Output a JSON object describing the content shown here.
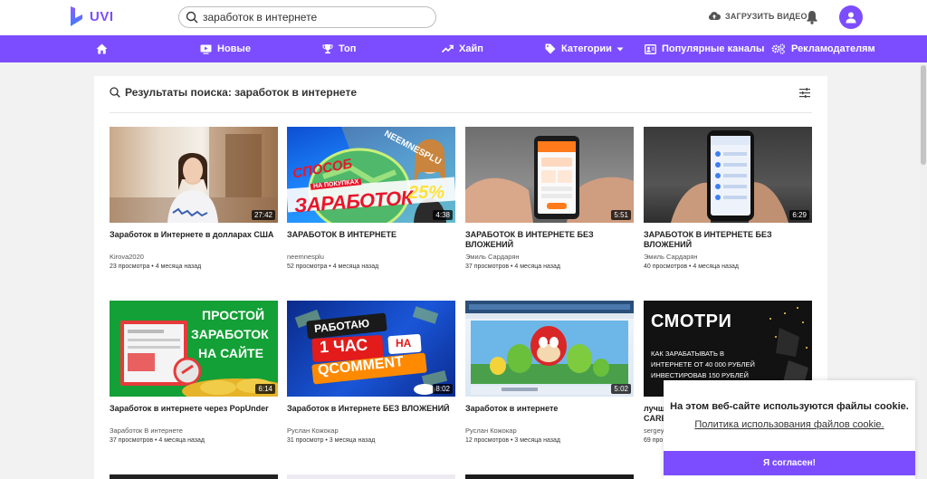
{
  "header": {
    "logo_text": "UVI",
    "search_value": "заработок в интернете",
    "upload_label": "ЗАГРУЗИТЬ ВИДЕО"
  },
  "nav": {
    "items": [
      "Новые",
      "Топ",
      "Хайп",
      "Категории",
      "Популярные каналы",
      "Рекламодателям"
    ]
  },
  "results": {
    "heading": "Результаты поиска: заработок в интернете"
  },
  "videos": [
    {
      "title": "Заработок в Интернете в долларах США",
      "author": "Kirova2020",
      "meta": "23 просмотра • 4 месяца назад",
      "duration": "27:42"
    },
    {
      "title": "ЗАРАБОТОК В ИНТЕРНЕТЕ",
      "author": "neemnesplu",
      "meta": "52 просмотра • 4 месяца назад",
      "duration": "4:38",
      "thumb_text": [
        "СПОСОБ",
        "НА ПОКУПКАХ",
        "ЗАРАБОТОК",
        "25%",
        "NEEMNESPLU"
      ]
    },
    {
      "title": "ЗАРАБОТОК В ИНТЕРНЕТЕ БЕЗ ВЛОЖЕНИЙ",
      "author": "Эмиль Сардарян",
      "meta": "37 просмотров • 4 месяца назад",
      "duration": "5:51"
    },
    {
      "title": "ЗАРАБОТОК В ИНТЕРНЕТЕ БЕЗ ВЛОЖЕНИЙ",
      "author": "Эмиль Сардарян",
      "meta": "40 просмотров • 4 месяца назад",
      "duration": "6:29"
    },
    {
      "title": "Заработок в интернете через PopUnder",
      "author": "Заработок В интернете",
      "meta": "37 просмотров • 4 месяца назад",
      "duration": "6:14",
      "thumb_text": [
        "ПРОСТОЙ",
        "ЗАРАБОТОК",
        "НА САЙТЕ"
      ]
    },
    {
      "title": "Заработок в Интернете БЕЗ ВЛОЖЕНИЙ",
      "author": "Руслан Кожокар",
      "meta": "31 просмотр • 3 месяца назад",
      "duration": "8:02",
      "thumb_text": [
        "РАБОТАЮ",
        "1 ЧАС",
        "НА",
        "QCOMMENT"
      ]
    },
    {
      "title": "Заработок в интернете",
      "author": "Руслан Кожокар",
      "meta": "12 просмотров • 3 месяца назад",
      "duration": "5:02"
    },
    {
      "title": "лучш CARE",
      "author": "sergey",
      "meta": "69 про",
      "duration": "",
      "thumb_text": [
        "СМОТРИ",
        "КАК ЗАРАБАТЫВАТЬ В",
        "ИНТЕРНЕТЕ ОТ 40 000 РУБЛЕЙ",
        "ИНВЕСТИРОВАВ 150 РУБЛЕЙ"
      ]
    }
  ],
  "cookie": {
    "text": "На этом веб-сайте используются файлы cookie.",
    "link": "Политика использования файлов cookie.",
    "button": "Я согласен!"
  },
  "colors": {
    "accent": "#7c4dff"
  }
}
